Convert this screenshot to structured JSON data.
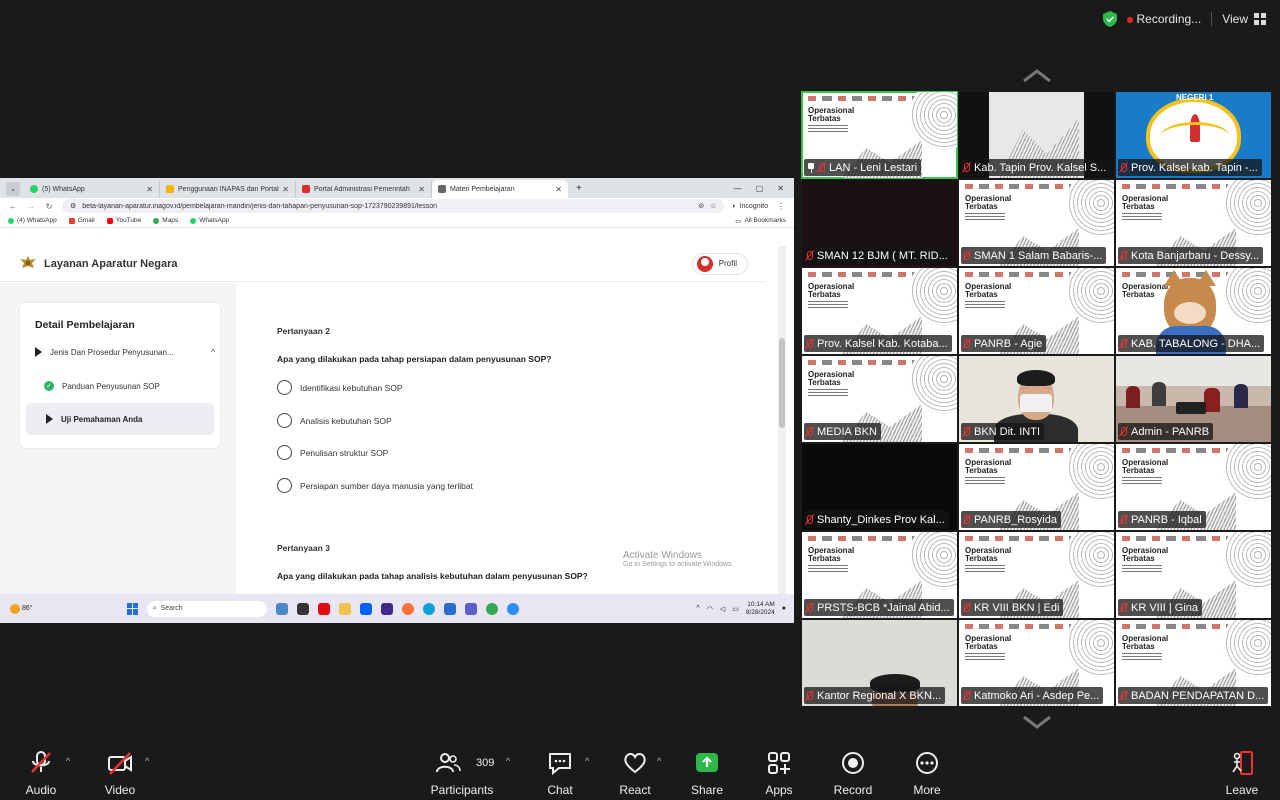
{
  "status": {
    "recording_label": "Recording...",
    "view_label": "View"
  },
  "browser": {
    "tabs": [
      {
        "title": "(5) WhatsApp",
        "color": "#25d366"
      },
      {
        "title": "Penggunaan INAPAS dan Portal",
        "color": "#f4b400"
      },
      {
        "title": "Portal Administrasi Pemerintah",
        "color": "#d93025"
      },
      {
        "title": "Materi Pembelajaran",
        "color": "#555555"
      }
    ],
    "url": "beta-layanan-aparatur.inagov.id/pembelajaran-mandiri/jenis-dan-tahapan-penyusunan-sop-1723790239891/lesson",
    "incognito_label": "Incognito",
    "bookmarks": [
      {
        "label": "(4) WhatsApp",
        "color": "#25d366"
      },
      {
        "label": "Gmail",
        "color": "#ea4335"
      },
      {
        "label": "YouTube",
        "color": "#ff0000"
      },
      {
        "label": "Maps",
        "color": "#34a853"
      },
      {
        "label": "WhatsApp",
        "color": "#25d366"
      }
    ],
    "all_bookmarks_label": "All Bookmarks"
  },
  "site": {
    "title": "Layanan Aparatur Negara",
    "profile_label": "Profil",
    "sidebar": {
      "title": "Detail Pembelajaran",
      "module": "Jenis Dan Prosedur Penyusunan...",
      "lessons": [
        "Panduan Penyusunan SOP",
        "Uji Pemahaman Anda"
      ]
    },
    "questions": [
      {
        "label": "Pertanyaan 2",
        "text": "Apa yang dilakukan pada tahap persiapan dalam penyusunan SOP?",
        "options": [
          "Identifikasi kebutuhan SOP",
          "Analisis kebutuhan SOP",
          "Penulisan struktur SOP",
          "Persiapan sumber daya manusia yang terlibat"
        ]
      },
      {
        "label": "Pertanyaan 3",
        "text": "Apa yang dilakukan pada tahap analisis kebutuhan dalam penyusunan SOP?"
      }
    ],
    "activate_windows": {
      "title": "Activate Windows",
      "subtitle": "Go to Settings to activate Windows."
    }
  },
  "taskbar": {
    "temp": "86°",
    "search_placeholder": "Search",
    "time": "10:14 AM",
    "date": "8/28/2024"
  },
  "gallery": {
    "tiles": [
      {
        "name": "LAN - Leni Lestari",
        "kind": "slide",
        "pinned": true
      },
      {
        "name": "Kab. Tapin Prov. Kalsel S...",
        "kind": "slide-dark"
      },
      {
        "name": "Prov. Kalsel kab. Tapin -...",
        "kind": "logo",
        "logo_text": "NEGERI 1"
      },
      {
        "name": "SMAN 12 BJM ( MT. RID...",
        "kind": "dark"
      },
      {
        "name": "SMAN 1 Salam Babaris-...",
        "kind": "slide"
      },
      {
        "name": "Kota Banjarbaru - Dessy...",
        "kind": "slide"
      },
      {
        "name": "Prov. Kalsel Kab. Kotaba...",
        "kind": "slide"
      },
      {
        "name": "PANRB - Agie",
        "kind": "slide"
      },
      {
        "name": "KAB. TABALONG - DHA...",
        "kind": "avatar"
      },
      {
        "name": "MEDIA BKN",
        "kind": "slide"
      },
      {
        "name": "BKN Dit. INTI",
        "kind": "person"
      },
      {
        "name": "Admin - PANRB",
        "kind": "room"
      },
      {
        "name": "Shanty_Dinkes Prov Kal...",
        "kind": "dark"
      },
      {
        "name": "PANRB_Rosyida",
        "kind": "slide"
      },
      {
        "name": "PANRB - Iqbal",
        "kind": "slide"
      },
      {
        "name": "PRSTS-BCB *Jainal Abid...",
        "kind": "slide"
      },
      {
        "name": "KR VIII BKN | Edi",
        "kind": "slide"
      },
      {
        "name": "KR VIII | Gina",
        "kind": "slide"
      },
      {
        "name": "Kantor Regional X BKN...",
        "kind": "person2"
      },
      {
        "name": "Katmoko Ari - Asdep Pe...",
        "kind": "slide"
      },
      {
        "name": "BADAN PENDAPATAN D...",
        "kind": "slide"
      }
    ],
    "slide_title_line1": "Operasional",
    "slide_title_line2": "Terbatas"
  },
  "toolbar": {
    "audio": "Audio",
    "video": "Video",
    "participants": "Participants",
    "participants_count": "309",
    "chat": "Chat",
    "react": "React",
    "share": "Share",
    "apps": "Apps",
    "record": "Record",
    "more": "More",
    "leave": "Leave"
  }
}
